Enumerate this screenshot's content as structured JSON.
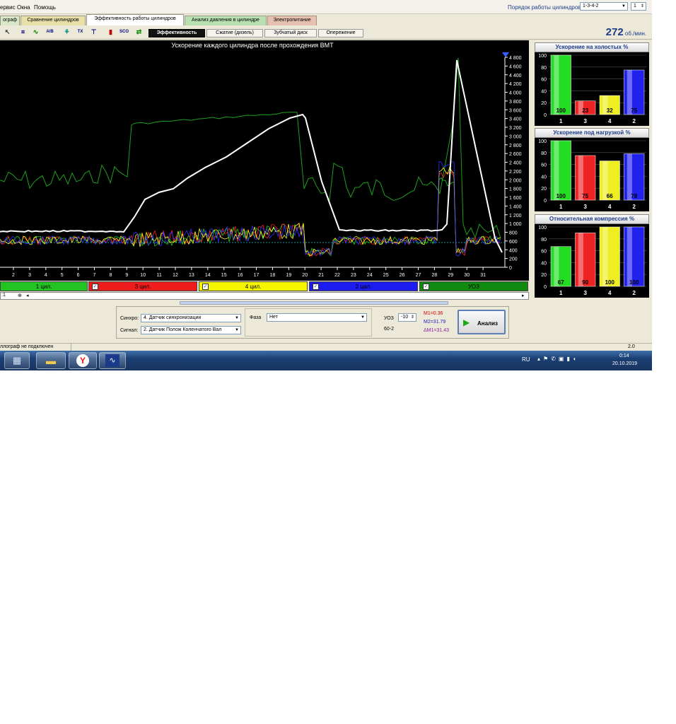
{
  "menu": {
    "items": [
      "ервис",
      "Окна",
      "Помощь"
    ],
    "firing_order_label": "Порядок работы цилиндров",
    "firing_order_value": "1-3-4-2",
    "cylinder_value": "1"
  },
  "tabs": [
    {
      "label": "ограф",
      "color": "#d8e8c8"
    },
    {
      "label": "Сравнение цилиндров",
      "color": "#e8e0a8"
    },
    {
      "label": "Эффективность работы цилиндров",
      "color": "#ffffff"
    },
    {
      "label": "Анализ давления в цилиндре",
      "color": "#b8e0b0"
    },
    {
      "label": "Электропитание",
      "color": "#e8c0b0"
    }
  ],
  "subtabs": [
    "Эффективность",
    "Сжатие (дизель)",
    "Зубчатый диск",
    "Опережение"
  ],
  "toolbar_icons": [
    "cursor-icon",
    "zoom-icon",
    "wave-icon",
    "ab-icon",
    "tree-icon",
    "tx-icon",
    "trig-icon",
    "bars-icon",
    "scope-icon",
    "arrows-icon"
  ],
  "rpm": {
    "value": "272",
    "unit": "об./мин."
  },
  "chart": {
    "title": "Ускорение каждого цилиндра после прохождения ВМТ",
    "y_ticks": [
      "4 800",
      "4 600",
      "4 400",
      "4 200",
      "4 000",
      "3 800",
      "3 600",
      "3 400",
      "3 200",
      "3 000",
      "2 800",
      "2 600",
      "2 400",
      "2 200",
      "2 000",
      "1 800",
      "1 600",
      "1 400",
      "1 200",
      "1 000",
      "800",
      "600",
      "400",
      "200",
      "0"
    ],
    "x_ticks": [
      "2",
      "3",
      "4",
      "5",
      "6",
      "7",
      "8",
      "9",
      "10",
      "11",
      "12",
      "13",
      "14",
      "15",
      "16",
      "17",
      "18",
      "19",
      "20",
      "21",
      "22",
      "23",
      "24",
      "25",
      "26",
      "27",
      "28",
      "29",
      "30",
      "31"
    ],
    "legend": [
      {
        "label": "1 цил.",
        "color": "#22c322"
      },
      {
        "label": "3 цил.",
        "color": "#ee1c1c"
      },
      {
        "label": "4 цил.",
        "color": "#f5f500"
      },
      {
        "label": "2 цил.",
        "color": "#1c1cee"
      },
      {
        "label": "УОЗ",
        "color": "#108a10"
      }
    ],
    "scroll_label": ":1"
  },
  "chart_data": [
    {
      "type": "bar",
      "title": "Ускорение на холостых %",
      "categories": [
        "1",
        "3",
        "4",
        "2"
      ],
      "values": [
        100,
        23,
        32,
        75
      ],
      "colors": [
        "#22dd22",
        "#ee2222",
        "#eeee22",
        "#2222ee"
      ],
      "ylim": [
        0,
        100
      ],
      "y_ticks": [
        "100",
        "80",
        "60",
        "40",
        "20",
        "0"
      ]
    },
    {
      "type": "bar",
      "title": "Ускорение под нагрузкой %",
      "categories": [
        "1",
        "3",
        "4",
        "2"
      ],
      "values": [
        100,
        75,
        66,
        78
      ],
      "colors": [
        "#22dd22",
        "#ee2222",
        "#eeee22",
        "#2222ee"
      ],
      "ylim": [
        0,
        100
      ],
      "y_ticks": [
        "100",
        "80",
        "60",
        "40",
        "20",
        "0"
      ]
    },
    {
      "type": "bar",
      "title": "Относительная компрессия %",
      "categories": [
        "1",
        "3",
        "4",
        "2"
      ],
      "values": [
        67,
        90,
        100,
        100
      ],
      "colors": [
        "#22dd22",
        "#ee2222",
        "#eeee22",
        "#2222ee"
      ],
      "ylim": [
        0,
        100
      ],
      "y_ticks": [
        "100",
        "80",
        "60",
        "40",
        "20",
        "0"
      ]
    }
  ],
  "controls": {
    "sync_label": "Синхро:",
    "sync_value": "4.  Датчик синхронизации",
    "signal_label": "Сигнал:",
    "signal_value": "2.  Датчик Полож Коленчатого Вал",
    "phase_label": "Фаза",
    "phase_value": "Нет",
    "uoz_label": "УОЗ",
    "uoz_value": "-10",
    "gear_label": "60-2",
    "m1": "M1=0.36",
    "m2": "M2=31.79",
    "dm": "ΔM1=31.43",
    "analyze_label": "Анализ"
  },
  "status": {
    "left": "ллограф не подключен",
    "right": "2.0"
  },
  "taskbar": {
    "lang": "RU",
    "time": "0:14",
    "date": "20.10.2019"
  }
}
